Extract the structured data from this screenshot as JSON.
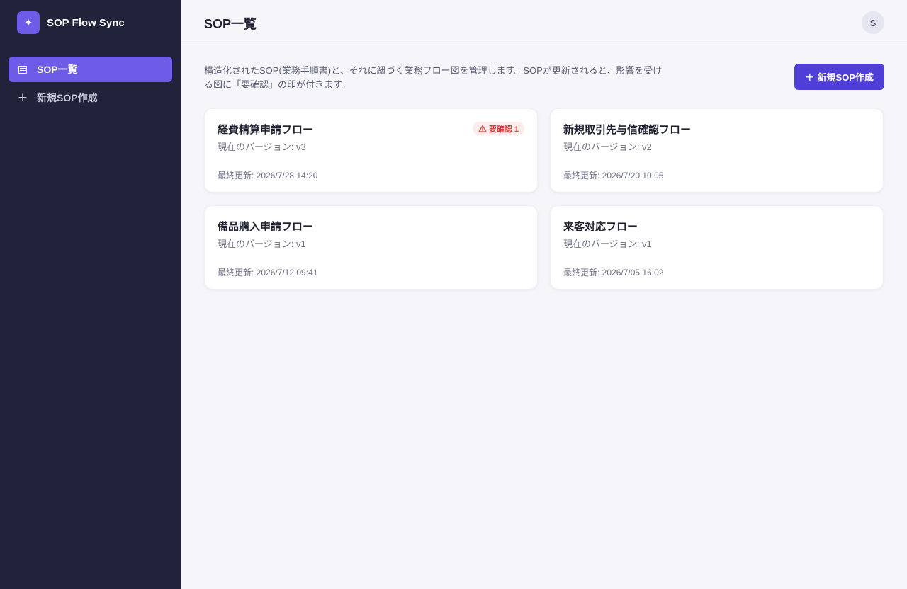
{
  "app": {
    "name": "SOP Flow Sync",
    "logo_glyph": "✦"
  },
  "sidebar": {
    "items": [
      {
        "label": "SOP一覧",
        "icon": "list-icon",
        "active": true
      },
      {
        "label": "新規SOP作成",
        "icon": "plus-icon",
        "active": false
      }
    ]
  },
  "header": {
    "title": "SOP一覧",
    "avatar_initial": "S"
  },
  "main": {
    "description": "構造化されたSOP(業務手順書)と、それに紐づく業務フロー図を管理します。SOPが更新されると、影響を受ける図に「要確認」の印が付きます。",
    "new_button_label": "新規SOP作成",
    "cards": [
      {
        "title": "経費精算申請フロー",
        "version": "現在のバージョン: v3",
        "updated": "最終更新: 2026/7/28 14:20",
        "badge": "要確認 1"
      },
      {
        "title": "新規取引先与信確認フロー",
        "version": "現在のバージョン: v2",
        "updated": "最終更新: 2026/7/20 10:05"
      },
      {
        "title": "備品購入申請フロー",
        "version": "現在のバージョン: v1",
        "updated": "最終更新: 2026/7/12 09:41"
      },
      {
        "title": "来客対応フロー",
        "version": "現在のバージョン: v1",
        "updated": "最終更新: 2026/7/05 16:02"
      }
    ]
  },
  "colors": {
    "sidebar_bg": "#21233a",
    "accent": "#6c5ce7",
    "button": "#4f3fd6",
    "warning": "#d33a3a"
  }
}
